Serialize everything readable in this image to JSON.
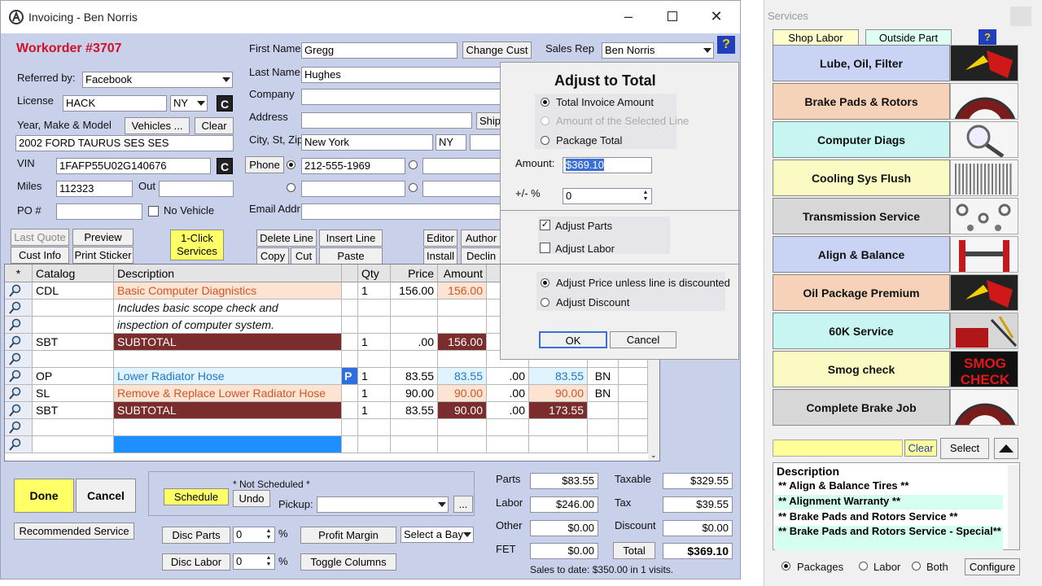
{
  "window": {
    "title": "Invoicing - Ben Norris"
  },
  "workorder": "Workorder #3707",
  "customer": {
    "first_name_label": "First Name",
    "first_name": "Gregg",
    "last_name_label": "Last Name",
    "last_name": "Hughes",
    "company_label": "Company",
    "company": "",
    "address_label": "Address",
    "address": "",
    "city_label": "City, St, Zip",
    "city": "New York",
    "state": "NY",
    "zip": "",
    "phone_label": "Phone",
    "phone1": "212-555-1969",
    "email_label": "Email Addr",
    "email": "",
    "change_cust": "Change Cust",
    "ship": "Ship",
    "sales_rep_label": "Sales Rep",
    "sales_rep": "Ben Norris"
  },
  "vehicle": {
    "referred_label": "Referred by:",
    "referred": "Facebook",
    "license_label": "License",
    "license": "HACK",
    "license_state": "NY",
    "ymm_label": "Year, Make & Model",
    "vehicles_btn": "Vehicles ...",
    "clear_btn": "Clear",
    "ymm": "2002 FORD TAURUS SES SES",
    "vin_label": "VIN",
    "vin": "1FAFP55U02G140676",
    "miles_label": "Miles",
    "miles": "112323",
    "out_label": "Out",
    "out": "",
    "po_label": "PO #",
    "po": "",
    "no_vehicle": "No Vehicle",
    "c_icon": "C"
  },
  "toolbar": {
    "last_quote": "Last Quote",
    "preview": "Preview",
    "cust_info": "Cust Info",
    "print_sticker": "Print Sticker",
    "one_click": "1-Click Services",
    "delete_line": "Delete Line",
    "insert_line": "Insert Line",
    "copy": "Copy",
    "cut": "Cut",
    "paste": "Paste",
    "editor": "Editor",
    "author": "Author",
    "install": "Install",
    "decline": "Declin"
  },
  "grid": {
    "headers": [
      "*",
      "Catalog",
      "Description",
      "",
      "Qty",
      "Price",
      "Amount"
    ],
    "rows": [
      {
        "cat": "CDL",
        "desc": "Basic Computer Diagnistics",
        "qty": "1",
        "price": "156.00",
        "amount": "156.00",
        "disc": "",
        "total": "",
        "who": ""
      },
      {
        "cat": "",
        "desc": "Includes basic scope check and",
        "qty": "",
        "price": "",
        "amount": "",
        "disc": "",
        "total": "",
        "who": ""
      },
      {
        "cat": "",
        "desc": "inspection of computer system.",
        "qty": "",
        "price": "",
        "amount": "",
        "disc": "",
        "total": "",
        "who": ""
      },
      {
        "cat": "SBT",
        "desc": "SUBTOTAL",
        "qty": "1",
        "price": ".00",
        "amount": "156.00",
        "disc": "",
        "total": "",
        "who": ""
      },
      {
        "cat": "",
        "desc": "",
        "qty": "",
        "price": "",
        "amount": "",
        "disc": "",
        "total": "",
        "who": ""
      },
      {
        "cat": "OP",
        "desc": "Lower Radiator Hose",
        "p": "P",
        "qty": "1",
        "price": "83.55",
        "amount": "83.55",
        "disc": ".00",
        "total": "83.55",
        "who": "BN"
      },
      {
        "cat": "SL",
        "desc": "Remove & Replace Lower Radiator Hose",
        "qty": "1",
        "price": "90.00",
        "amount": "90.00",
        "disc": ".00",
        "total": "90.00",
        "who": "BN"
      },
      {
        "cat": "SBT",
        "desc": "SUBTOTAL",
        "qty": "1",
        "price": "83.55",
        "amount": "90.00",
        "disc": ".00",
        "total": "173.55",
        "who": ""
      },
      {
        "cat": "",
        "desc": "",
        "qty": "",
        "price": "",
        "amount": "",
        "disc": "",
        "total": "",
        "who": ""
      },
      {
        "cat": "",
        "desc": "",
        "qty": "",
        "price": "",
        "amount": "",
        "disc": "",
        "total": "",
        "who": ""
      }
    ]
  },
  "bottom": {
    "done": "Done",
    "cancel": "Cancel",
    "recommended": "Recommended Service",
    "schedule": "Schedule",
    "not_scheduled": "* Not Scheduled *",
    "undo": "Undo",
    "pickup_label": "Pickup:",
    "pickup": "",
    "ellipsis": "...",
    "disc_parts": "Disc Parts",
    "disc_parts_val": "0",
    "disc_labor": "Disc Labor",
    "disc_labor_val": "0",
    "pct": "%",
    "profit_margin": "Profit Margin",
    "select_bay": "Select a Bay",
    "toggle_columns": "Toggle Columns",
    "parts_label": "Parts",
    "parts": "$83.55",
    "labor_label": "Labor",
    "labor": "$246.00",
    "other_label": "Other",
    "other": "$0.00",
    "fet_label": "FET",
    "fet": "$0.00",
    "taxable_label": "Taxable",
    "taxable": "$329.55",
    "tax_label": "Tax",
    "tax": "$39.55",
    "discount_label": "Discount",
    "discount": "$0.00",
    "total_btn": "Total",
    "total": "$369.10",
    "sales_to_date": "Sales to date: $350.00 in 1 visits."
  },
  "dialog": {
    "title": "Adjust to Total",
    "opt1": "Total Invoice Amount",
    "opt2": "Amount of the Selected Line",
    "opt3": "Package Total",
    "amount_label": "Amount:",
    "amount": "$369.10",
    "pm_label": "+/- %",
    "pm": "0",
    "adjust_parts": "Adjust Parts",
    "adjust_labor": "Adjust Labor",
    "adj_price": "Adjust Price unless line is discounted",
    "adj_discount": "Adjust Discount",
    "ok": "OK",
    "cancel": "Cancel"
  },
  "services": {
    "title": "Services",
    "tab_shop": "Shop Labor",
    "tab_outside": "Outside Part",
    "items": [
      {
        "label": "Lube, Oil, Filter",
        "color": "#c9d4f5"
      },
      {
        "label": "Brake Pads & Rotors",
        "color": "#f6d3b8"
      },
      {
        "label": "Computer Diags",
        "color": "#c6f5f2"
      },
      {
        "label": "Cooling Sys Flush",
        "color": "#fafac3"
      },
      {
        "label": "Transmission Service",
        "color": "#d7d7d7"
      },
      {
        "label": "Align & Balance",
        "color": "#c9d4f5"
      },
      {
        "label": "Oil Package Premium",
        "color": "#f6d3b8"
      },
      {
        "label": "60K Service",
        "color": "#c6f5f2"
      },
      {
        "label": "Smog check",
        "color": "#fafac3"
      },
      {
        "label": "Complete Brake Job",
        "color": "#d7d7d7"
      }
    ],
    "smog_text": "SMOG CHECK",
    "clear": "Clear",
    "select": "Select",
    "desc_header": "Description",
    "desc_items": [
      "** Align & Balance Tires **",
      "** Alignment Warranty **",
      "** Brake Pads and Rotors Service **",
      "** Brake Pads and Rotors Service - Special**"
    ],
    "r_packages": "Packages",
    "r_labor": "Labor",
    "r_both": "Both",
    "configure": "Configure"
  }
}
